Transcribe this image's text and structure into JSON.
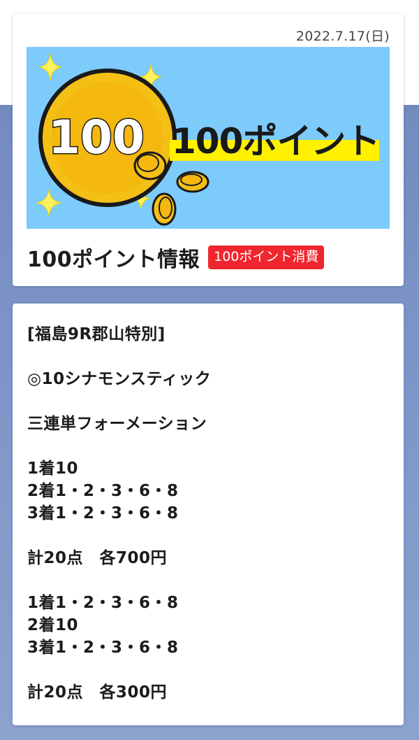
{
  "header": {
    "date": "2022.7.17(日)",
    "banner": {
      "coin_text": "100",
      "banner_text": "100ポイント",
      "colors": {
        "sky": "#7dcbfb",
        "coin": "#f5c016",
        "highlight": "#fff100",
        "sparkle": "#fff25a"
      }
    },
    "title": "100ポイント情報",
    "badge": "100ポイント消費"
  },
  "content": {
    "race": "[福島9R郡山特別]",
    "pick": "◎10シナモンスティック",
    "bet_type": "三連単フォーメーション",
    "formation1": {
      "first": "1着10",
      "second": "2着1・2・3・6・8",
      "third": "3着1・2・3・6・8",
      "total": "計20点　各700円"
    },
    "formation2": {
      "first": "1着1・2・3・6・8",
      "second": "2着10",
      "third": "3着1・2・3・6・8",
      "total": "計20点　各300円"
    }
  }
}
